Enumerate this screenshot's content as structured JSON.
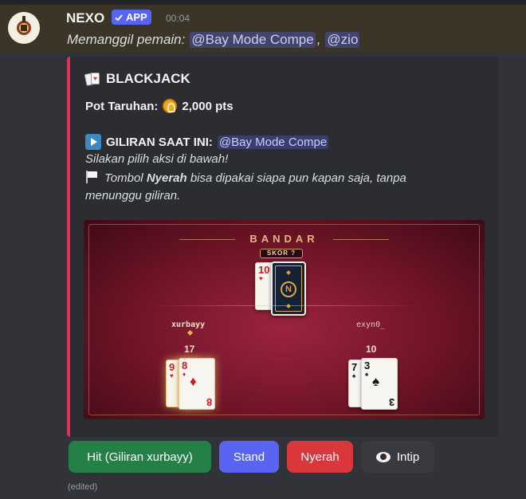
{
  "message": {
    "username": "NEXO",
    "app_badge": "APP",
    "timestamp": "00:04",
    "summon_text": "Memanggil pemain:",
    "mentions": [
      "@Bay Mode Compe",
      "@zio"
    ],
    "comma": ",",
    "edited": "(edited)"
  },
  "embed": {
    "accent_color": "#e52e56",
    "title": "BLACKJACK",
    "pot_label": "Pot Taruhan:",
    "pot_value": "2,000 pts",
    "turn_label": "GILIRAN SAAT INI:",
    "turn_mention": "@Bay Mode Compe",
    "instruction": "Silakan pilih aksi di bawah!",
    "note_prefix": "Tombol ",
    "note_bold": "Nyerah",
    "note_rest": " bisa dipakai siapa pun kapan saja, tanpa",
    "note_line2": "menunggu giliran."
  },
  "table": {
    "dealer_label": "BANDAR",
    "dealer_score": "SKOR  ?",
    "dealer_card": {
      "rank": "10",
      "suit": "♥"
    },
    "card_back_logo": "N",
    "players": [
      {
        "name": "xurbayy",
        "score": "17",
        "cards": [
          {
            "rank": "9",
            "suit": "♥"
          },
          {
            "rank": "8",
            "suit": "♦"
          }
        ]
      },
      {
        "name": "exyn0_",
        "score": "10",
        "cards": [
          {
            "rank": "7",
            "suit": "♠"
          },
          {
            "rank": "3",
            "suit": "♠"
          }
        ]
      }
    ]
  },
  "buttons": {
    "hit": "Hit (Giliran xurbayy)",
    "stand": "Stand",
    "surrender": "Nyerah",
    "peek": "Intip"
  },
  "colors": {
    "hit": "#248046",
    "stand": "#5865f2",
    "surrender": "#da373c",
    "peek": "#383a40"
  },
  "icons": [
    "check-icon",
    "playing-cards-icon",
    "coin-icon",
    "play-icon",
    "white-flag-icon",
    "eye-icon"
  ]
}
